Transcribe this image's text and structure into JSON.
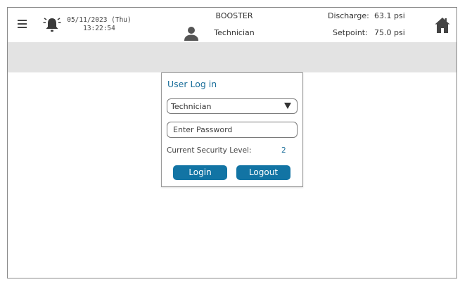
{
  "header": {
    "date": "05/11/2023 (Thu)",
    "time": "13:22:54",
    "title": "BOOSTER",
    "user": "Technician",
    "discharge_label": "Discharge:",
    "discharge_value": "63.1 psi",
    "setpoint_label": "Setpoint:",
    "setpoint_value": "75.0 psi",
    "icons": [
      "menu-icon",
      "alarm-bell-icon",
      "user-icon",
      "home-icon"
    ]
  },
  "login_dialog": {
    "title": "User Log in",
    "user_select": {
      "selected": "Technician"
    },
    "password": {
      "placeholder": "Enter Password",
      "value": ""
    },
    "security_level_label": "Current Security Level:",
    "security_level_value": "2",
    "login_button": "Login",
    "logout_button": "Logout"
  },
  "colors": {
    "accent": "#1274a4",
    "title_text": "#1a6e9a",
    "band": "#e3e3e3"
  }
}
